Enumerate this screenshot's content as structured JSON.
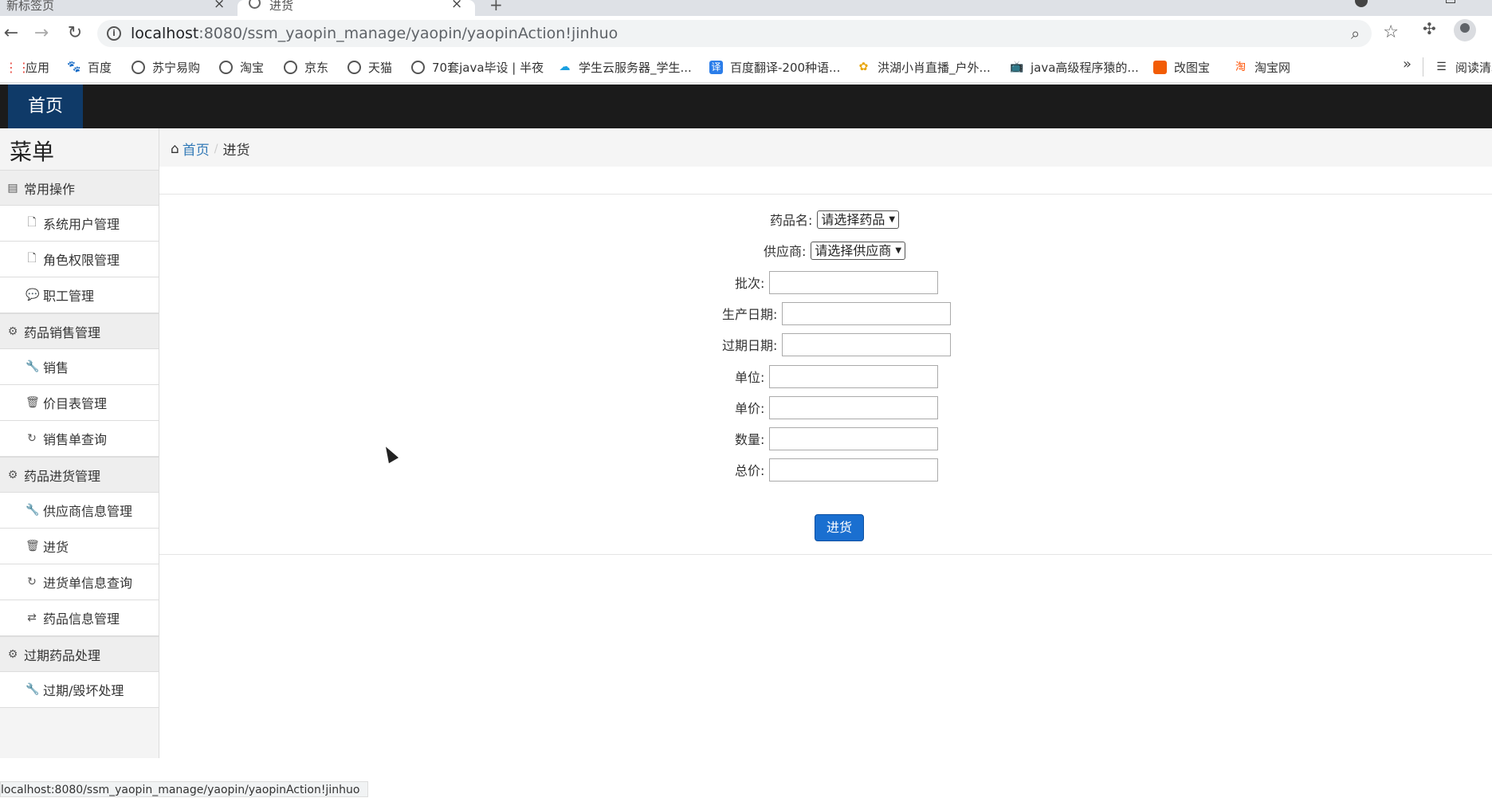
{
  "browser": {
    "tabs": [
      {
        "title": "新标签页"
      },
      {
        "title": "进货"
      }
    ],
    "new_tab_symbol": "+",
    "url_host": "localhost",
    "url_path": ":8080/ssm_yaopin_manage/yaopin/yaopinAction!jinhuo",
    "bookmarks": [
      {
        "label": "应用",
        "icon": "apps-grid-icon"
      },
      {
        "label": "百度",
        "icon": "baidu-paw-icon"
      },
      {
        "label": "苏宁易购",
        "icon": "globe-icon"
      },
      {
        "label": "淘宝",
        "icon": "globe-icon"
      },
      {
        "label": "京东",
        "icon": "globe-icon"
      },
      {
        "label": "天猫",
        "icon": "globe-icon"
      },
      {
        "label": "70套java毕设 | 半夜",
        "icon": "globe-icon"
      },
      {
        "label": "学生云服务器_学生...",
        "icon": "cloud-icon"
      },
      {
        "label": "百度翻译-200种语...",
        "icon": "translate-icon"
      },
      {
        "label": "洪湖小肖直播_户外...",
        "icon": "huya-icon"
      },
      {
        "label": "java高级程序猿的...",
        "icon": "bilibili-icon"
      },
      {
        "label": "改图宝",
        "icon": "gaitubao-icon"
      },
      {
        "label": "淘宝网",
        "icon": "taobao-icon"
      }
    ],
    "bookmarks_overflow": "»",
    "reading_list": "阅读清单",
    "status_url": "localhost:8080/ssm_yaopin_manage/yaopin/yaopinAction!jinhuo"
  },
  "topnav": {
    "home_label": "首页"
  },
  "sidebar": {
    "title": "菜单",
    "groups": [
      {
        "label": "常用操作",
        "icon": "list-icon",
        "items": [
          {
            "label": "系统用户管理",
            "icon": "file-icon"
          },
          {
            "label": "角色权限管理",
            "icon": "file-icon"
          },
          {
            "label": "职工管理",
            "icon": "comment-icon"
          }
        ]
      },
      {
        "label": "药品销售管理",
        "icon": "gear-icon",
        "items": [
          {
            "label": "销售",
            "icon": "wrench-icon"
          },
          {
            "label": "价目表管理",
            "icon": "trash-icon"
          },
          {
            "label": "销售单查询",
            "icon": "refresh-icon"
          }
        ]
      },
      {
        "label": "药品进货管理",
        "icon": "gear-icon",
        "items": [
          {
            "label": "供应商信息管理",
            "icon": "wrench-icon"
          },
          {
            "label": "进货",
            "icon": "trash-icon"
          },
          {
            "label": "进货单信息查询",
            "icon": "refresh-icon"
          },
          {
            "label": "药品信息管理",
            "icon": "retweet-icon"
          }
        ]
      },
      {
        "label": "过期药品处理",
        "icon": "gear-icon",
        "items": [
          {
            "label": "过期/毁坏处理",
            "icon": "wrench-icon"
          }
        ]
      }
    ]
  },
  "breadcrumb": {
    "home": "首页",
    "separator": "/",
    "current": "进货"
  },
  "form": {
    "drug_label": "药品名:",
    "drug_select": "请选择药品",
    "supplier_label": "供应商:",
    "supplier_select": "请选择供应商",
    "batch_label": "批次:",
    "batch_value": "",
    "production_date_label": "生产日期:",
    "production_date_value": "",
    "expiry_date_label": "过期日期:",
    "expiry_date_value": "",
    "unit_label": "单位:",
    "unit_value": "",
    "unit_price_label": "单价:",
    "unit_price_value": "",
    "quantity_label": "数量:",
    "quantity_value": "",
    "total_label": "总价:",
    "total_value": "",
    "submit_label": "进货"
  },
  "colors": {
    "topnav_bg": "#1b1b1b",
    "topnav_active": "#0f3a68",
    "submit_button": "#1a6fd0",
    "breadcrumb_link": "#337ab7"
  }
}
